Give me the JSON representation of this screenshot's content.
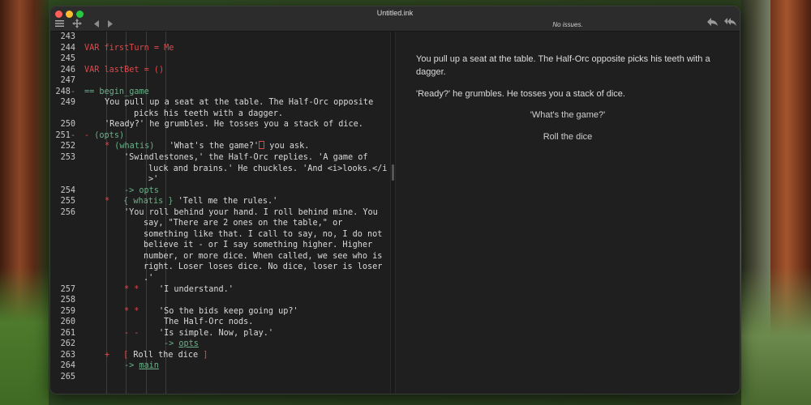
{
  "window": {
    "title": "Untitled.ink",
    "status": "No issues."
  },
  "icons": {
    "menu": "menu-icon",
    "navigate": "navigate-icon",
    "back": "back-arrow-icon",
    "forward": "forward-arrow-icon",
    "rewind_one": "rewind-icon",
    "rewind_all": "rewind-all-icon"
  },
  "editor": {
    "line_numbers": [
      "243",
      "244",
      "245",
      "246",
      "247",
      "248",
      "249",
      "",
      "250",
      "251",
      "252",
      "253",
      "",
      "",
      "254",
      "255",
      "256",
      "",
      "",
      "",
      "",
      "",
      "",
      "257",
      "258",
      "259",
      "260",
      "261",
      "262",
      "263",
      "264",
      "265"
    ],
    "fold_markers": {
      "248": "-",
      "251": "-"
    },
    "lines": {
      "l244": "VAR firstTurn = Me",
      "l246": "VAR lastBet = ()",
      "l248": "== begin_game",
      "l249a": "You pull up a seat at the table. The Half-Orc opposite",
      "l249b": "picks his teeth with a dagger.",
      "l250": "'Ready?' he grumbles. He tosses you a stack of dice.",
      "l251_dash": "- ",
      "l251": "(opts)",
      "l252_star": "* ",
      "l252_label": "(whatis)",
      "l252_text": "   'What's the game?'",
      "l252_after": " you ask.",
      "l253a": "'Swindlestones,' the Half-Orc replies. 'A game of",
      "l253b": "luck and brains.' He chuckles. 'And <i>looks.</i",
      "l253c": ">'",
      "l254": "-> opts",
      "l255_star": "*",
      "l255_cond": "{ whatis }",
      "l255_text": " 'Tell me the rules.'",
      "l256a": "'You roll behind your hand. I roll behind mine. You",
      "l256b": "say, \"There are 2 ones on the table,\" or",
      "l256c": "something like that. I call to say, no, I do not",
      "l256d": "believe it - or I say something higher. Higher",
      "l256e": "number, or more dice. When called, we see who is",
      "l256f": "right. Loser loses dice. No dice, loser is loser",
      "l256g": ".'",
      "l257_stars": "* *",
      "l257": "    'I understand.'",
      "l259_stars": "* *",
      "l259": "    'So the bids keep going up?'",
      "l260": "The Half-Orc nods.",
      "l261_dashes": "- -",
      "l261": "    'Is simple. Now, play.'",
      "l262_arrow": "-> ",
      "l262_target": "opts",
      "l263_plus": "+",
      "l263_open": "[",
      "l263": " Roll the dice ",
      "l263_close": "]",
      "l264_arrow": "-> ",
      "l264_target": "main"
    }
  },
  "preview": {
    "paragraphs": [
      "You pull up a seat at the table. The Half-Orc opposite picks his teeth with a dagger.",
      "'Ready?' he grumbles. He tosses you a stack of dice."
    ],
    "choices": [
      "'What's the game?'",
      "Roll the dice"
    ]
  },
  "colors": {
    "keyword_red": "#e0484a",
    "knot_green": "#6bb08a",
    "editor_bg": "#1e1e1e",
    "preview_bg": "#1f1f1f"
  }
}
